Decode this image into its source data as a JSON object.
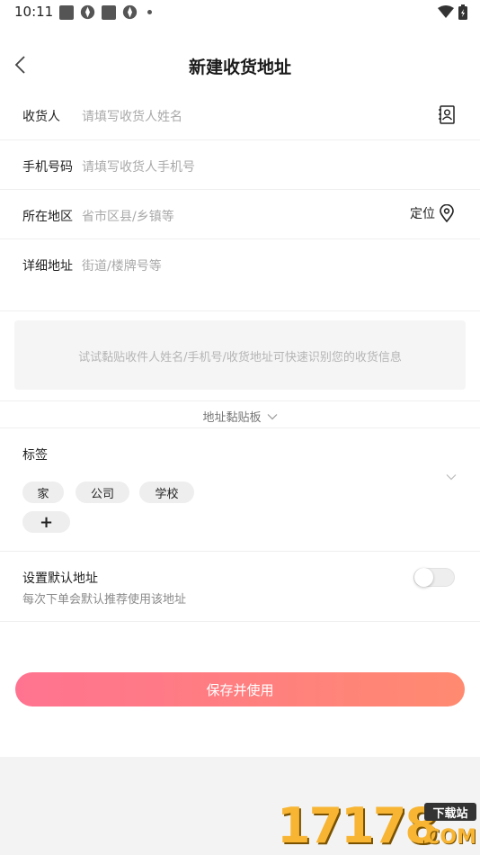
{
  "status_bar": {
    "time": "10:11"
  },
  "nav": {
    "title": "新建收货地址"
  },
  "form": {
    "receiver": {
      "label": "收货人",
      "placeholder": "请填写收货人姓名"
    },
    "phone": {
      "label": "手机号码",
      "placeholder": "请填写收货人手机号"
    },
    "region": {
      "label": "所在地区",
      "placeholder": "省市区县/乡镇等",
      "locate_label": "定位"
    },
    "detail": {
      "label": "详细地址",
      "placeholder": "街道/楼牌号等"
    }
  },
  "paste": {
    "hint": "试试黏贴收件人姓名/手机号/收货地址可快速识别您的收货信息"
  },
  "clipboard": {
    "label": "地址黏贴板"
  },
  "tags": {
    "title": "标签",
    "items": [
      "家",
      "公司",
      "学校"
    ],
    "add_label": "+"
  },
  "default_address": {
    "title": "设置默认地址",
    "subtitle": "每次下单会默认推荐使用该地址",
    "enabled": false
  },
  "save_button": {
    "label": "保存并使用"
  },
  "watermark": {
    "digits": "17178",
    "tag": "下载站",
    "domain": ".COM"
  },
  "colors": {
    "accent_start": "#ff7390",
    "accent_end": "#ff8a70"
  }
}
